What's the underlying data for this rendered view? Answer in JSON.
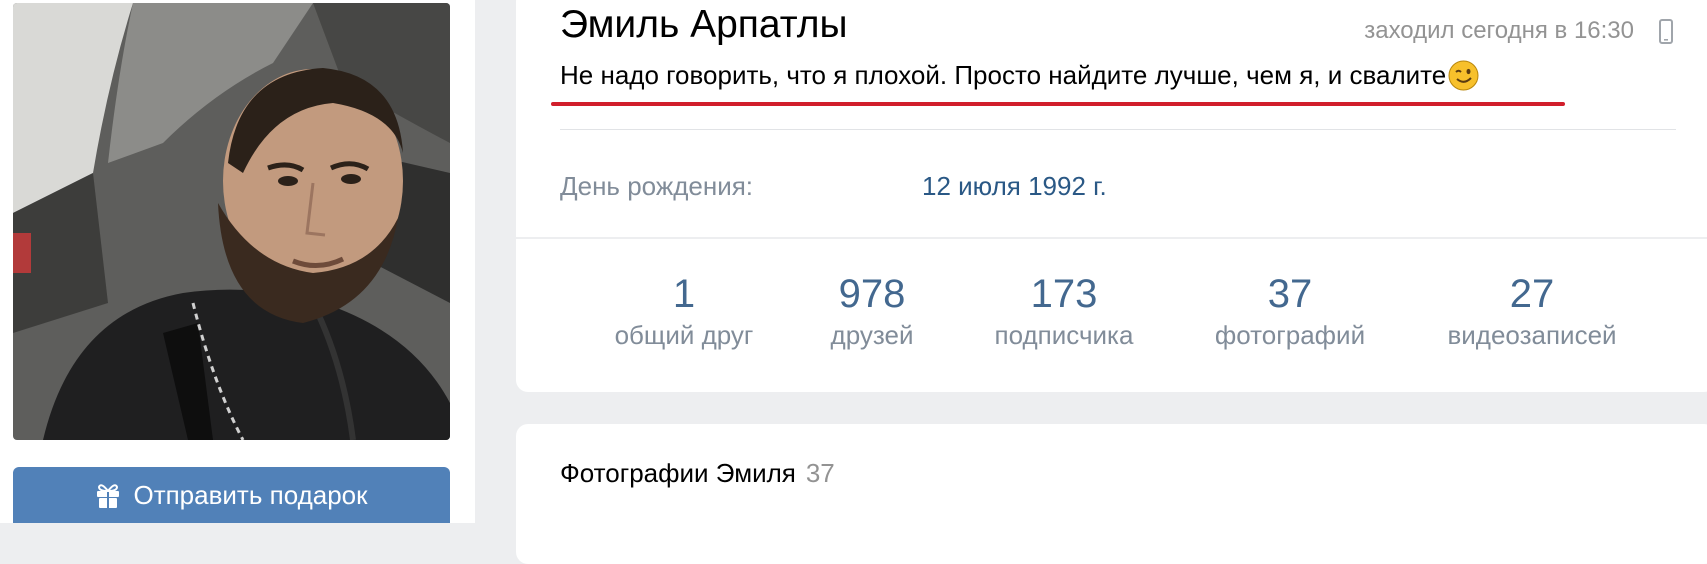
{
  "profile": {
    "name": "Эмиль Арпатлы",
    "online": "заходил сегодня в 16:30",
    "status": "Не надо говорить, что я плохой. Просто найдите лучше, чем я, и свалите",
    "birthday_label": "День рождения:",
    "birthday_value": "12 июля 1992 г."
  },
  "counters": [
    {
      "num": "1",
      "label": "общий друг"
    },
    {
      "num": "978",
      "label": "друзей"
    },
    {
      "num": "173",
      "label": "подписчика"
    },
    {
      "num": "37",
      "label": "фотографий"
    },
    {
      "num": "27",
      "label": "видеозаписей"
    }
  ],
  "actions": {
    "gift_label": "Отправить подарок"
  },
  "photos": {
    "title": "Фотографии Эмиля",
    "count": "37"
  },
  "colors": {
    "accent": "#5181b8",
    "link": "#2a5885",
    "counter": "#43688f",
    "muted": "#818c99",
    "underline": "#d11e2b"
  },
  "icons": {
    "online_device": "mobile-phone-icon",
    "gift": "gift-icon",
    "emoji": "winking-face-emoji"
  }
}
